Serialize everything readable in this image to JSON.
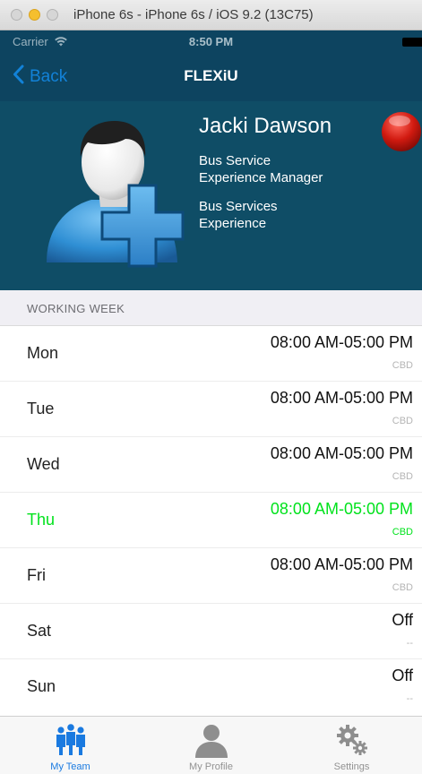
{
  "window": {
    "title": "iPhone 6s - iPhone 6s / iOS 9.2 (13C75)"
  },
  "status_bar": {
    "carrier": "Carrier",
    "time": "8:50 PM"
  },
  "nav": {
    "back_label": "Back",
    "title": "FLEXiU"
  },
  "profile": {
    "name": "Jacki Dawson",
    "role_line1": "Bus Service",
    "role_line2": "Experience Manager",
    "dept_line1": "Bus Services",
    "dept_line2": "Experience",
    "status_color": "#d11a10"
  },
  "section": {
    "title": "WORKING WEEK"
  },
  "schedule": [
    {
      "day": "Mon",
      "hours": "08:00 AM-05:00 PM",
      "location": "CBD",
      "today": false
    },
    {
      "day": "Tue",
      "hours": "08:00 AM-05:00 PM",
      "location": "CBD",
      "today": false
    },
    {
      "day": "Wed",
      "hours": "08:00 AM-05:00 PM",
      "location": "CBD",
      "today": false
    },
    {
      "day": "Thu",
      "hours": "08:00 AM-05:00 PM",
      "location": "CBD",
      "today": true
    },
    {
      "day": "Fri",
      "hours": "08:00 AM-05:00 PM",
      "location": "CBD",
      "today": false
    },
    {
      "day": "Sat",
      "hours": "Off",
      "location": "--",
      "today": false
    },
    {
      "day": "Sun",
      "hours": "Off",
      "location": "--",
      "today": false
    }
  ],
  "tabs": [
    {
      "label": "My Team",
      "icon": "team-icon",
      "active": true
    },
    {
      "label": "My Profile",
      "icon": "profile-icon",
      "active": false
    },
    {
      "label": "Settings",
      "icon": "gears-icon",
      "active": false
    }
  ],
  "colors": {
    "nav_background": "#0d4460",
    "profile_background": "#0f4d66",
    "accent_blue": "#1282d8",
    "today_green": "#00e21c"
  }
}
